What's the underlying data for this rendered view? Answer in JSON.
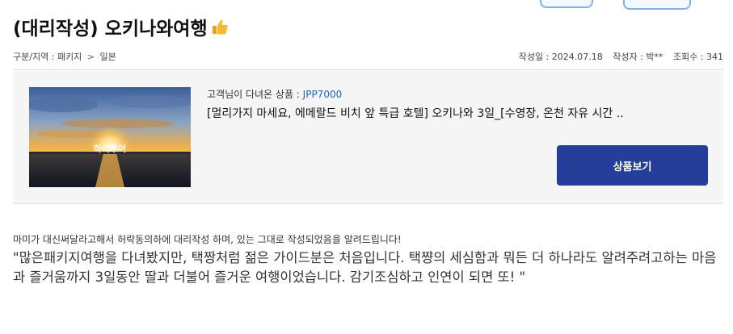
{
  "post": {
    "title": "(대리작성) 오키나와여행",
    "title_icon": "thumbs-up-icon"
  },
  "breadcrumb": {
    "label": "구분/지역 : 패키지",
    "separator": ">",
    "region": "일본"
  },
  "post_info": {
    "date": "작성일 : 2024.07.18",
    "author": "작성자 : 박**",
    "views": "조회수 : 341"
  },
  "product": {
    "image_overlay_text": "하이투어",
    "code_label": "고객님이 다녀온 상품 : ",
    "code": "JPP7000",
    "name": "[멀리가지 마세요, 에메랄드 비치 앞 특급 호텔] 오키나와 3일_[수영장, 온천 자유 시간 ..",
    "view_button": "상품보기"
  },
  "notice": "마미가 대신써달라고해서 허락동의하에 대리작성 하며, 있는 그대로 작성되었음을 알려드립니다!",
  "review_text": "\"많은패키지여행을 다녀봤지만, 택짱처럼 젊은 가이드분은 처음입니다.  택쨩의 세심함과 뭐든 더 하나라도 알려주려고하는 마음과 즐거움까지 3일동안 딸과 더불어 즐거운 여행이었습니다. 감기조심하고 인연이 되면 또! \"",
  "colors": {
    "accent": "#253e9a",
    "code": "#1a67c9"
  }
}
